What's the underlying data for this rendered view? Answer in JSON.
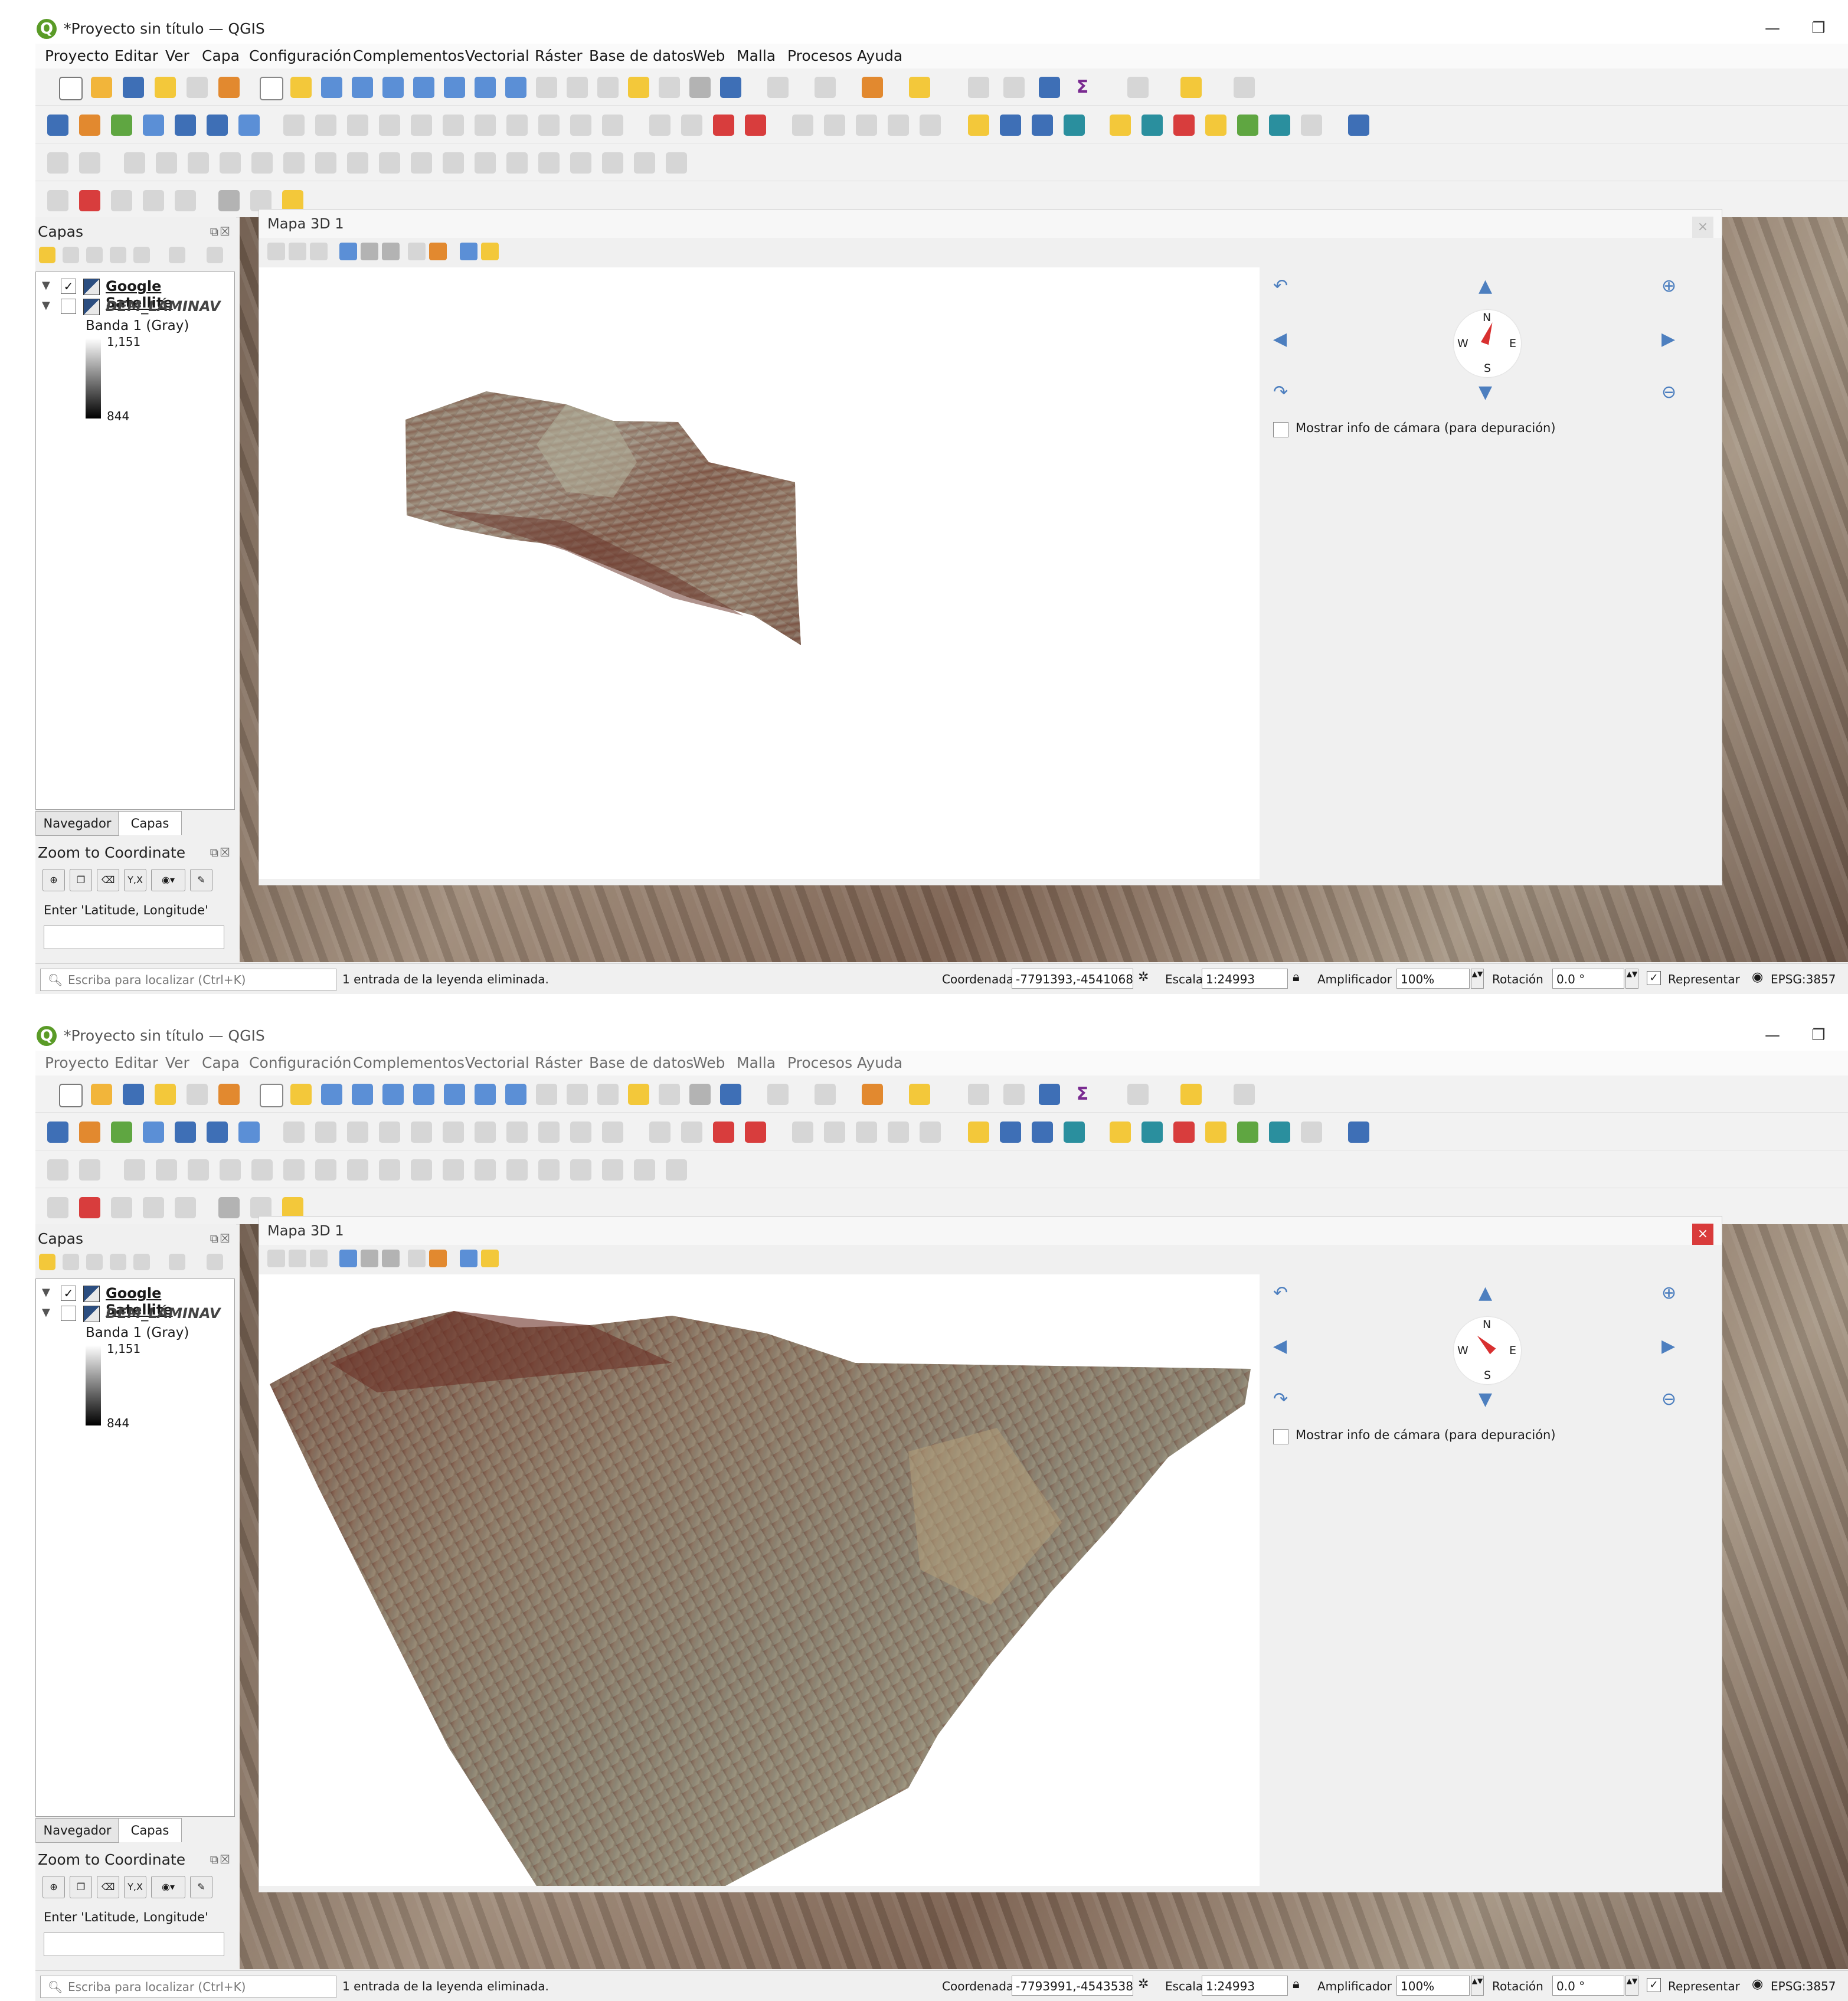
{
  "screenshots": [
    {
      "window_title": "*Proyecto sin título — QGIS",
      "menu": [
        "Proyecto",
        "Editar",
        "Ver",
        "Capa",
        "Configuración",
        "Complementos",
        "Vectorial",
        "Ráster",
        "Base de datos",
        "Web",
        "Malla",
        "Procesos",
        "Ayuda"
      ],
      "layers_panel": {
        "title": "Capas",
        "layers": [
          {
            "name": "Google Satellite",
            "checked": true
          },
          {
            "name": "DEM_LÁMINAV",
            "checked": false
          }
        ],
        "band_label": "Banda 1 (Gray)",
        "ramp_max": "1,151",
        "ramp_min": "844"
      },
      "tabs": [
        "Navegador",
        "Capas"
      ],
      "zoom_panel": {
        "title": "Zoom to Coordinate",
        "hint": "Enter 'Latitude, Longitude'",
        "yx_label": "Y,X"
      },
      "map3d": {
        "title": "Mapa 3D 1",
        "close_active": false,
        "compass": {
          "n": "N",
          "s": "S",
          "e": "E",
          "w": "W"
        },
        "camera_info_label": "Mostrar info de cámara (para depuración)"
      },
      "status": {
        "search_placeholder": "Escriba para localizar (Ctrl+K)",
        "message": "1 entrada de la leyenda eliminada.",
        "coord_label": "Coordenada",
        "coord_value": "-7791393,-4541068",
        "scale_label": "Escala",
        "scale_value": "1:24993",
        "magnifier_label": "Amplificador",
        "magnifier_value": "100%",
        "rotation_label": "Rotación",
        "rotation_value": "0.0 °",
        "render_label": "Representar",
        "crs": "EPSG:3857"
      }
    },
    {
      "window_title": "*Proyecto sin título — QGIS",
      "menu": [
        "Proyecto",
        "Editar",
        "Ver",
        "Capa",
        "Configuración",
        "Complementos",
        "Vectorial",
        "Ráster",
        "Base de datos",
        "Web",
        "Malla",
        "Procesos",
        "Ayuda"
      ],
      "layers_panel": {
        "title": "Capas",
        "layers": [
          {
            "name": "Google Satellite",
            "checked": true
          },
          {
            "name": "DEM_LÁMINAV",
            "checked": false
          }
        ],
        "band_label": "Banda 1 (Gray)",
        "ramp_max": "1,151",
        "ramp_min": "844"
      },
      "tabs": [
        "Navegador",
        "Capas"
      ],
      "zoom_panel": {
        "title": "Zoom to Coordinate",
        "hint": "Enter 'Latitude, Longitude'",
        "yx_label": "Y,X"
      },
      "map3d": {
        "title": "Mapa 3D 1",
        "close_active": true,
        "compass": {
          "n": "N",
          "s": "S",
          "e": "E",
          "w": "W"
        },
        "camera_info_label": "Mostrar info de cámara (para depuración)"
      },
      "status": {
        "search_placeholder": "Escriba para localizar (Ctrl+K)",
        "message": "1 entrada de la leyenda eliminada.",
        "coord_label": "Coordenada",
        "coord_value": "-7793991,-4543538",
        "scale_label": "Escala",
        "scale_value": "1:24993",
        "magnifier_label": "Amplificador",
        "magnifier_value": "100%",
        "rotation_label": "Rotación",
        "rotation_value": "0.0 °",
        "render_label": "Representar",
        "crs": "EPSG:3857"
      }
    }
  ],
  "colors": {
    "qgis_green": "#5a9b27",
    "close_red": "#d93b3b",
    "nav_blue": "#4d7fbf",
    "needle_red": "#d83030"
  }
}
